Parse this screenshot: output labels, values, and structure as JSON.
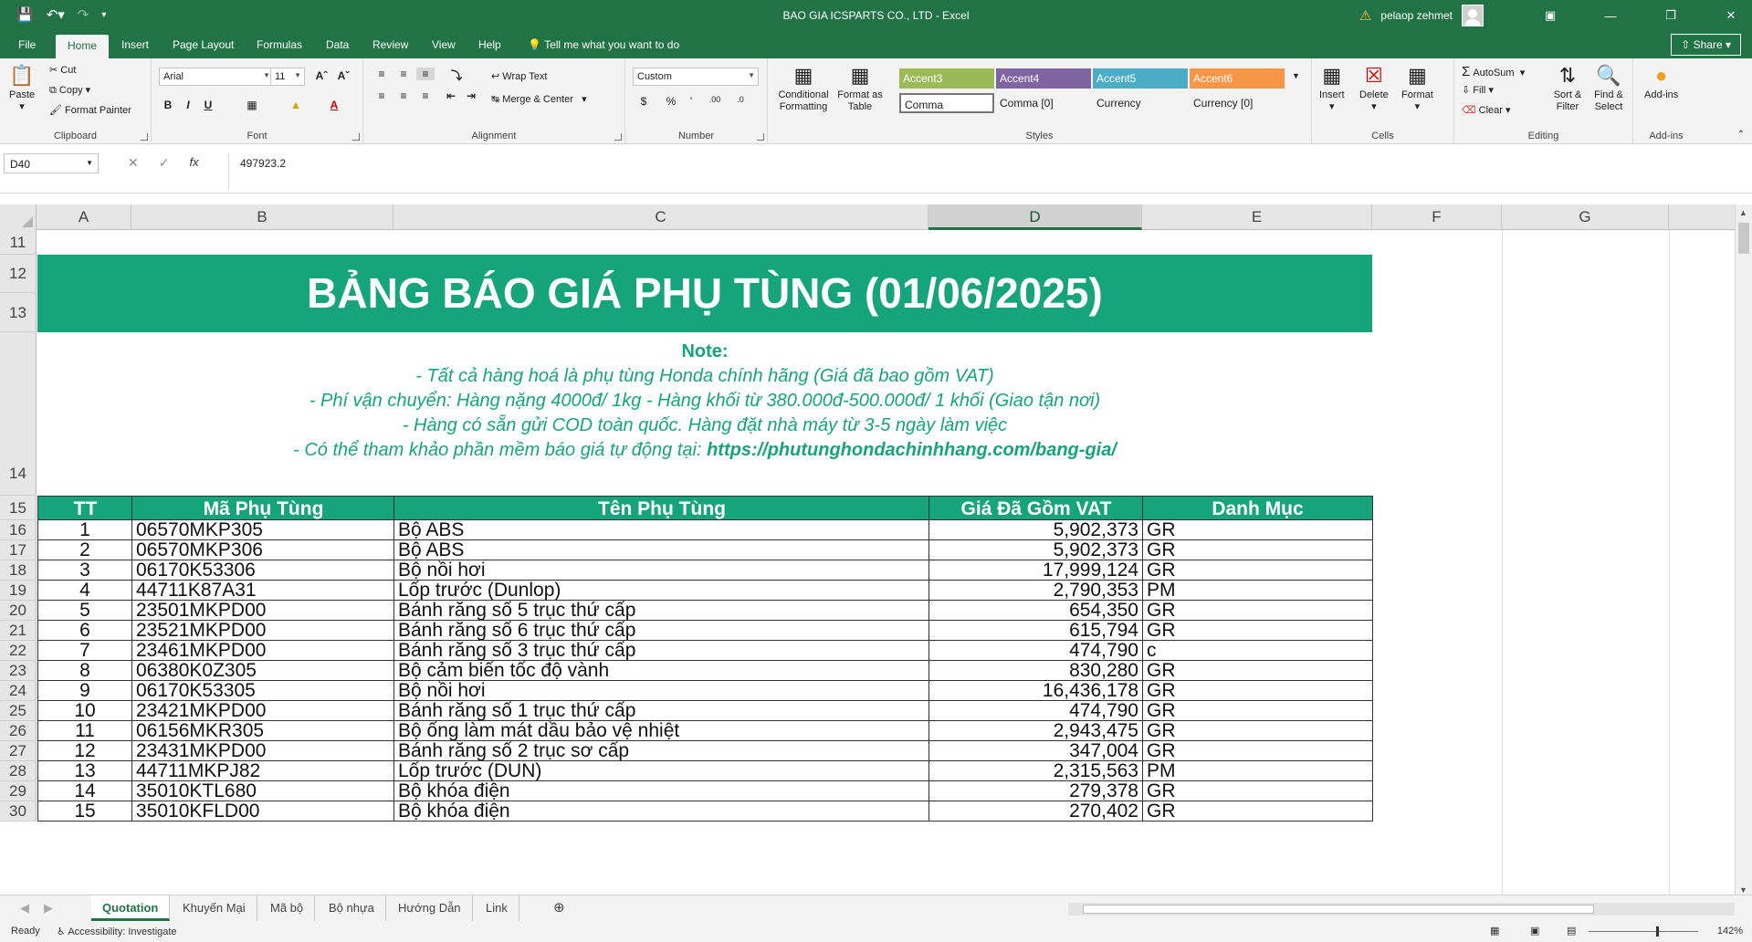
{
  "window": {
    "title": "BAO GIA ICSPARTS CO., LTD  -  Excel",
    "user": "pelaop zehmet",
    "controls": [
      "—",
      "❐",
      "✕"
    ]
  },
  "tabs": [
    "File",
    "Home",
    "Insert",
    "Page Layout",
    "Formulas",
    "Data",
    "Review",
    "View",
    "Help"
  ],
  "tell_me": "Tell me what you want to do",
  "share": "Share",
  "ribbon": {
    "clipboard": {
      "paste": "Paste",
      "cut": "Cut",
      "copy": "Copy",
      "format_painter": "Format Painter",
      "label": "Clipboard"
    },
    "font": {
      "name": "Arial",
      "size": "11",
      "label": "Font"
    },
    "alignment": {
      "wrap": "Wrap Text",
      "merge": "Merge & Center",
      "label": "Alignment"
    },
    "number": {
      "format": "Custom",
      "label": "Number"
    },
    "styles": {
      "conditional": "Conditional Formatting",
      "format_table": "Format as Table",
      "cells": [
        {
          "name": "Accent3",
          "bg": "#9bbb59"
        },
        {
          "name": "Accent4",
          "bg": "#8064a2"
        },
        {
          "name": "Accent5",
          "bg": "#4bacc6"
        },
        {
          "name": "Accent6",
          "bg": "#f79646"
        },
        {
          "name": "Comma"
        },
        {
          "name": "Comma [0]"
        },
        {
          "name": "Currency"
        },
        {
          "name": "Currency [0]"
        }
      ],
      "label": "Styles"
    },
    "cells": {
      "insert": "Insert",
      "delete": "Delete",
      "format": "Format",
      "label": "Cells"
    },
    "editing": {
      "autosum": "AutoSum",
      "fill": "Fill",
      "clear": "Clear",
      "sort": "Sort & Filter",
      "find": "Find & Select",
      "label": "Editing"
    },
    "addins": {
      "addins": "Add-ins",
      "label": "Add-ins"
    }
  },
  "formula_bar": {
    "name_box": "D40",
    "formula": "497923.2"
  },
  "columns": [
    "A",
    "B",
    "C",
    "D",
    "E",
    "F",
    "G"
  ],
  "selected_column": "D",
  "row_numbers": {
    "r11": "11",
    "r12": "12",
    "r13": "13",
    "r14": "14",
    "r15": "15"
  },
  "sheet": {
    "title": "BẢNG BÁO GIÁ PHỤ TÙNG (01/06/2025)",
    "note_heading": "Note:",
    "notes": [
      "- Tất cả hàng hoá là phụ tùng Honda chính hãng (Giá đã bao gồm VAT)",
      "- Phí vận chuyển: Hàng nặng 4000đ/ 1kg - Hàng khối từ 380.000đ-500.000đ/ 1 khối (Giao tận nơi)",
      "- Hàng có sẵn gửi COD toàn quốc. Hàng đặt nhà máy từ 3-5 ngày làm việc"
    ],
    "note_link_prefix": "- Có thể tham khảo phần mềm báo giá tự động tại:  ",
    "note_link": "https://phutunghondachinhhang.com/bang-gia/",
    "headers": [
      "TT",
      "Mã Phụ Tùng",
      "Tên Phụ Tùng",
      "Giá Đã Gồm VAT",
      "Danh Mục"
    ],
    "rows": [
      {
        "rn": "16",
        "tt": "1",
        "code": "06570MKP305",
        "name": "Bộ ABS",
        "price": "5,902,373",
        "cat": "GR"
      },
      {
        "rn": "17",
        "tt": "2",
        "code": "06570MKP306",
        "name": "Bộ ABS",
        "price": "5,902,373",
        "cat": "GR"
      },
      {
        "rn": "18",
        "tt": "3",
        "code": "06170K53306",
        "name": "Bộ nồi hơi",
        "price": "17,999,124",
        "cat": "GR"
      },
      {
        "rn": "19",
        "tt": "4",
        "code": "44711K87A31",
        "name": "Lốp trước (Dunlop)",
        "price": "2,790,353",
        "cat": "PM"
      },
      {
        "rn": "20",
        "tt": "5",
        "code": "23501MKPD00",
        "name": "Bánh răng số 5 trục thứ cấp",
        "price": "654,350",
        "cat": "GR"
      },
      {
        "rn": "21",
        "tt": "6",
        "code": "23521MKPD00",
        "name": "Bánh răng số 6 trục thứ cấp",
        "price": "615,794",
        "cat": "GR"
      },
      {
        "rn": "22",
        "tt": "7",
        "code": "23461MKPD00",
        "name": "Bánh răng số 3 trục thứ cấp",
        "price": "474,790",
        "cat": "c"
      },
      {
        "rn": "23",
        "tt": "8",
        "code": "06380K0Z305",
        "name": "Bộ cảm biến tốc độ vành",
        "price": "830,280",
        "cat": "GR"
      },
      {
        "rn": "24",
        "tt": "9",
        "code": "06170K53305",
        "name": "Bộ nồi hơi",
        "price": "16,436,178",
        "cat": "GR"
      },
      {
        "rn": "25",
        "tt": "10",
        "code": "23421MKPD00",
        "name": "Bánh răng số 1 trục thứ cấp",
        "price": "474,790",
        "cat": "GR"
      },
      {
        "rn": "26",
        "tt": "11",
        "code": "06156MKR305",
        "name": "Bộ ống làm mát dầu bảo vệ nhiệt",
        "price": "2,943,475",
        "cat": "GR"
      },
      {
        "rn": "27",
        "tt": "12",
        "code": "23431MKPD00",
        "name": "Bánh răng số 2 trục sơ cấp",
        "price": "347,004",
        "cat": "GR"
      },
      {
        "rn": "28",
        "tt": "13",
        "code": "44711MKPJ82",
        "name": "Lốp trước (DUN)",
        "price": "2,315,563",
        "cat": "PM"
      },
      {
        "rn": "29",
        "tt": "14",
        "code": "35010KTL680",
        "name": "Bộ khóa điện",
        "price": "279,378",
        "cat": "GR"
      },
      {
        "rn": "30",
        "tt": "15",
        "code": "35010KFLD00",
        "name": "Bộ khóa điện",
        "price": "270,402",
        "cat": "GR"
      }
    ]
  },
  "sheet_tabs": [
    "Quotation",
    "Khuyến Mại",
    "Mã bộ",
    "Bộ nhựa",
    "Hướng Dẫn",
    "Link"
  ],
  "active_sheet": "Quotation",
  "status": {
    "ready": "Ready",
    "accessibility": "Accessibility: Investigate",
    "zoom": "142%"
  },
  "colors": {
    "excel_green": "#217346",
    "table_green": "#16a47c"
  }
}
